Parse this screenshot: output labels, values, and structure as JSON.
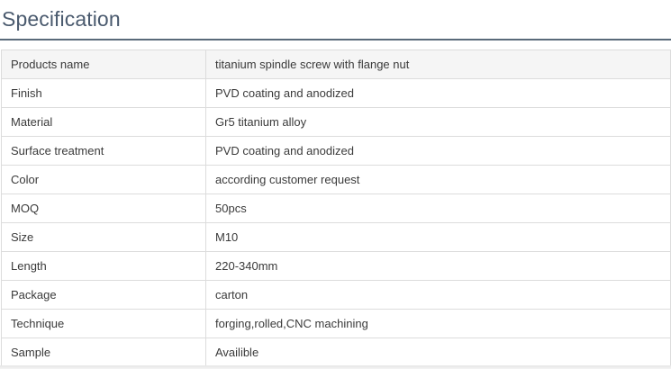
{
  "section": {
    "title": "Specification"
  },
  "spec_table": {
    "rows": [
      {
        "label": "Products name",
        "value": "titanium spindle screw with flange nut"
      },
      {
        "label": "Finish",
        "value": "PVD coating and anodized"
      },
      {
        "label": "Material",
        "value": "Gr5 titanium alloy"
      },
      {
        "label": "Surface treatment",
        "value": "PVD coating and anodized"
      },
      {
        "label": "Color",
        "value": "according customer request"
      },
      {
        "label": "MOQ",
        "value": "50pcs"
      },
      {
        "label": "Size",
        "value": "M10"
      },
      {
        "label": "Length",
        "value": "220-340mm"
      },
      {
        "label": "Package",
        "value": "carton"
      },
      {
        "label": "Technique",
        "value": "forging,rolled,CNC machining"
      },
      {
        "label": "Sample",
        "value": "Availible"
      }
    ]
  },
  "colors": {
    "title": "#4a5a6e",
    "rule": "#5a6a7a",
    "border": "#dcdcdc",
    "header_row_bg": "#f5f5f5"
  }
}
